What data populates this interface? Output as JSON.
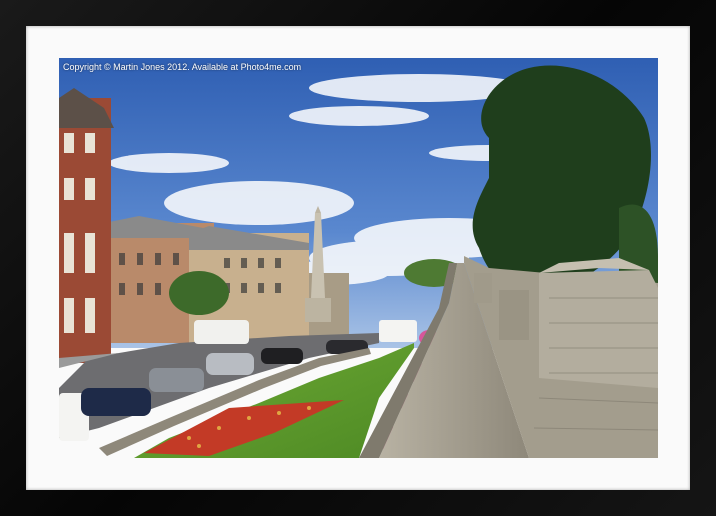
{
  "image": {
    "copyright_text": "Copyright © Martin Jones 2012. Available at Photo4me.com"
  },
  "colors": {
    "frame": "#0a0a0a",
    "mount": "#fafafa",
    "sky": "#3f6fbf",
    "lawn": "#5f9a2c",
    "wall_stone": "#a9a394"
  }
}
